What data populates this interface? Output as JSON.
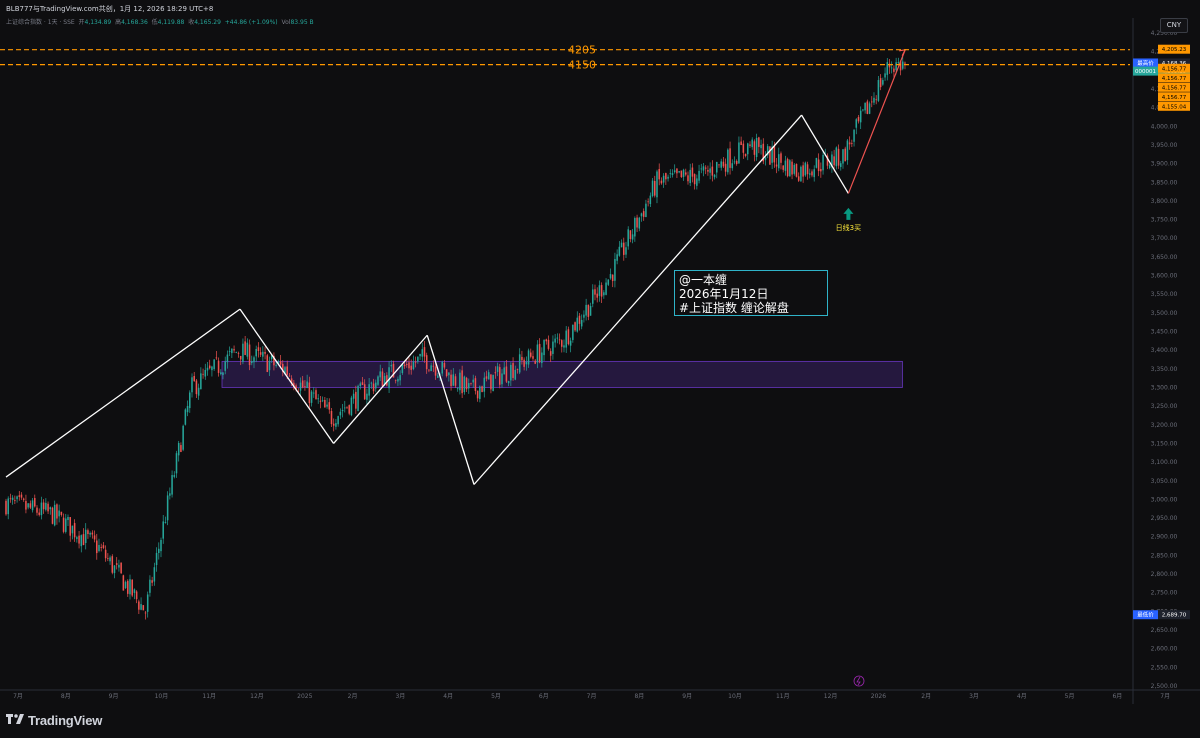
{
  "header": {
    "text": "BLB777与TradingView.com共创，1月 12, 2026 18:29 UTC+8"
  },
  "legend": {
    "symbol": "上证综合指数 · 1天 · SSE",
    "open_label": "开",
    "open": "4,134.89",
    "high_label": "高",
    "high": "4,168.36",
    "low_label": "低",
    "low": "4,119.88",
    "close_label": "收",
    "close": "4,165.29",
    "change": "+44.86 (+1.09%)",
    "vol_label": "Vol",
    "vol": "83.95 B"
  },
  "currency": "CNY",
  "annotation": {
    "line1": "@一本缠",
    "line2": "2026年1月12日",
    "line3": "#上证指数 缠论解盘"
  },
  "buy_signal_label": "日线3买",
  "brand": "TradingView",
  "colors": {
    "up": "#26a69a",
    "down": "#ef5350",
    "level_line": "#ff9800",
    "zone": "#7b3fe4",
    "pen": "#ffffff",
    "note_border": "#2fb3c8",
    "buy_arrow": "#089981"
  },
  "chart_data": {
    "type": "candlestick",
    "y_axis": {
      "min": 2500,
      "max": 4250,
      "ticks": [
        "4,250.00",
        "4,200.00",
        "4,150.00",
        "4,100.00",
        "4,050.00",
        "4,000.00",
        "3,950.00",
        "3,900.00",
        "3,850.00",
        "3,800.00",
        "3,750.00",
        "3,700.00",
        "3,650.00",
        "3,600.00",
        "3,550.00",
        "3,500.00",
        "3,450.00",
        "3,400.00",
        "3,350.00",
        "3,300.00",
        "3,250.00",
        "3,200.00",
        "3,150.00",
        "3,100.00",
        "3,050.00",
        "3,000.00",
        "2,950.00",
        "2,900.00",
        "2,850.00",
        "2,800.00",
        "2,750.00",
        "2,700.00",
        "2,650.00",
        "2,600.00",
        "2,550.00",
        "2,500.00"
      ]
    },
    "x_axis": {
      "ticks": [
        "7月",
        "8月",
        "9月",
        "10月",
        "11月",
        "12月",
        "2025",
        "2月",
        "3月",
        "4月",
        "5月",
        "6月",
        "7月",
        "8月",
        "9月",
        "10月",
        "11月",
        "12月",
        "2026",
        "2月",
        "3月",
        "4月",
        "5月",
        "6月",
        "7月"
      ]
    },
    "horizontal_levels": [
      {
        "label": "4205",
        "value": 4205.23
      },
      {
        "label": "4150",
        "value": 4165.29
      }
    ],
    "price_labels": [
      {
        "name": "最高价",
        "value": "4,168.36",
        "kind": "high"
      },
      {
        "name": "000001",
        "value": "4,165.29",
        "kind": "last"
      },
      {
        "name": "",
        "value": "4,205.23",
        "kind": "level"
      },
      {
        "name": "",
        "value": "4,156.77",
        "kind": "level"
      },
      {
        "name": "",
        "value": "4,156.77",
        "kind": "level"
      },
      {
        "name": "",
        "value": "4,156.77",
        "kind": "level"
      },
      {
        "name": "",
        "value": "4,156.77",
        "kind": "level"
      },
      {
        "name": "",
        "value": "4,155.04",
        "kind": "level"
      },
      {
        "name": "最低价",
        "value": "2,689.70",
        "kind": "low"
      }
    ],
    "pivot_zone": {
      "low": 3300,
      "high": 3370,
      "from": "2024-11",
      "to": "2025-12"
    },
    "pen_points": [
      {
        "date": "2024-06",
        "price": 3060
      },
      {
        "date": "2024-11",
        "price": 3510
      },
      {
        "date": "2025-01",
        "price": 3150
      },
      {
        "date": "2025-03",
        "price": 3440
      },
      {
        "date": "2025-04",
        "price": 3040
      },
      {
        "date": "2025-11",
        "price": 4030
      },
      {
        "date": "2025-12",
        "price": 3820
      }
    ],
    "price_series": [
      {
        "date": "2024-06",
        "close": 2990
      },
      {
        "date": "2024-07",
        "close": 2960
      },
      {
        "date": "2024-08",
        "close": 2870
      },
      {
        "date": "2024-09",
        "close": 2700
      },
      {
        "date": "2024-10",
        "close": 3300
      },
      {
        "date": "2024-11",
        "close": 3400
      },
      {
        "date": "2024-12",
        "close": 3350
      },
      {
        "date": "2025-01",
        "close": 3220
      },
      {
        "date": "2025-02",
        "close": 3320
      },
      {
        "date": "2025-03",
        "close": 3380
      },
      {
        "date": "2025-04",
        "close": 3290
      },
      {
        "date": "2025-05",
        "close": 3360
      },
      {
        "date": "2025-06",
        "close": 3430
      },
      {
        "date": "2025-07",
        "close": 3600
      },
      {
        "date": "2025-08",
        "close": 3850
      },
      {
        "date": "2025-09",
        "close": 3870
      },
      {
        "date": "2025-10",
        "close": 3950
      },
      {
        "date": "2025-11",
        "close": 3880
      },
      {
        "date": "2025-12",
        "close": 3920
      },
      {
        "date": "2026-01",
        "close": 4165
      }
    ]
  }
}
